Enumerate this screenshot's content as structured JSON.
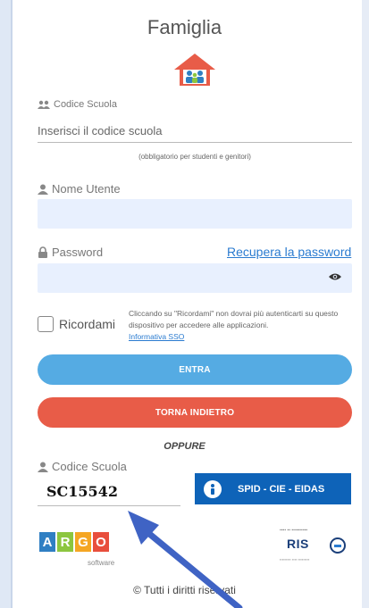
{
  "header": {
    "title": "Famiglia",
    "logo_icon": "home-family-icon"
  },
  "school_code": {
    "label": "Codice Scuola",
    "placeholder": "Inserisci il codice scuola",
    "note": "(obbligatorio per studenti e genitori)"
  },
  "username": {
    "label": "Nome Utente",
    "value": ""
  },
  "password": {
    "label": "Password",
    "recover_link": "Recupera la password",
    "value": ""
  },
  "remember": {
    "label": "Ricordami",
    "checked": false,
    "note": "Cliccando su \"Ricordami\" non dovrai più autenticarti su questo dispositivo per accedere alle applicazioni.",
    "note_link": "Informativa SSO"
  },
  "buttons": {
    "enter": "ENTRA",
    "back": "TORNA INDIETRO"
  },
  "oppure": "OPPURE",
  "spid_section": {
    "code_label": "Codice Scuola",
    "code_value": "SC15542",
    "spid_button": "SPID - CIE - EIDAS"
  },
  "footer": {
    "argo_letters": [
      "A",
      "R",
      "G",
      "O"
    ],
    "argo_colors": [
      "#2f7fc3",
      "#8cc63f",
      "#f5a623",
      "#e84e3c"
    ],
    "argo_sub": "software",
    "risa_word": "RIS",
    "rights": "© Tutti i diritti riservati"
  },
  "colors": {
    "enter": "#55abe3",
    "back": "#e85c48",
    "spid": "#0e63b8",
    "field": "#e8f0fe",
    "link": "#2a7bd0"
  }
}
